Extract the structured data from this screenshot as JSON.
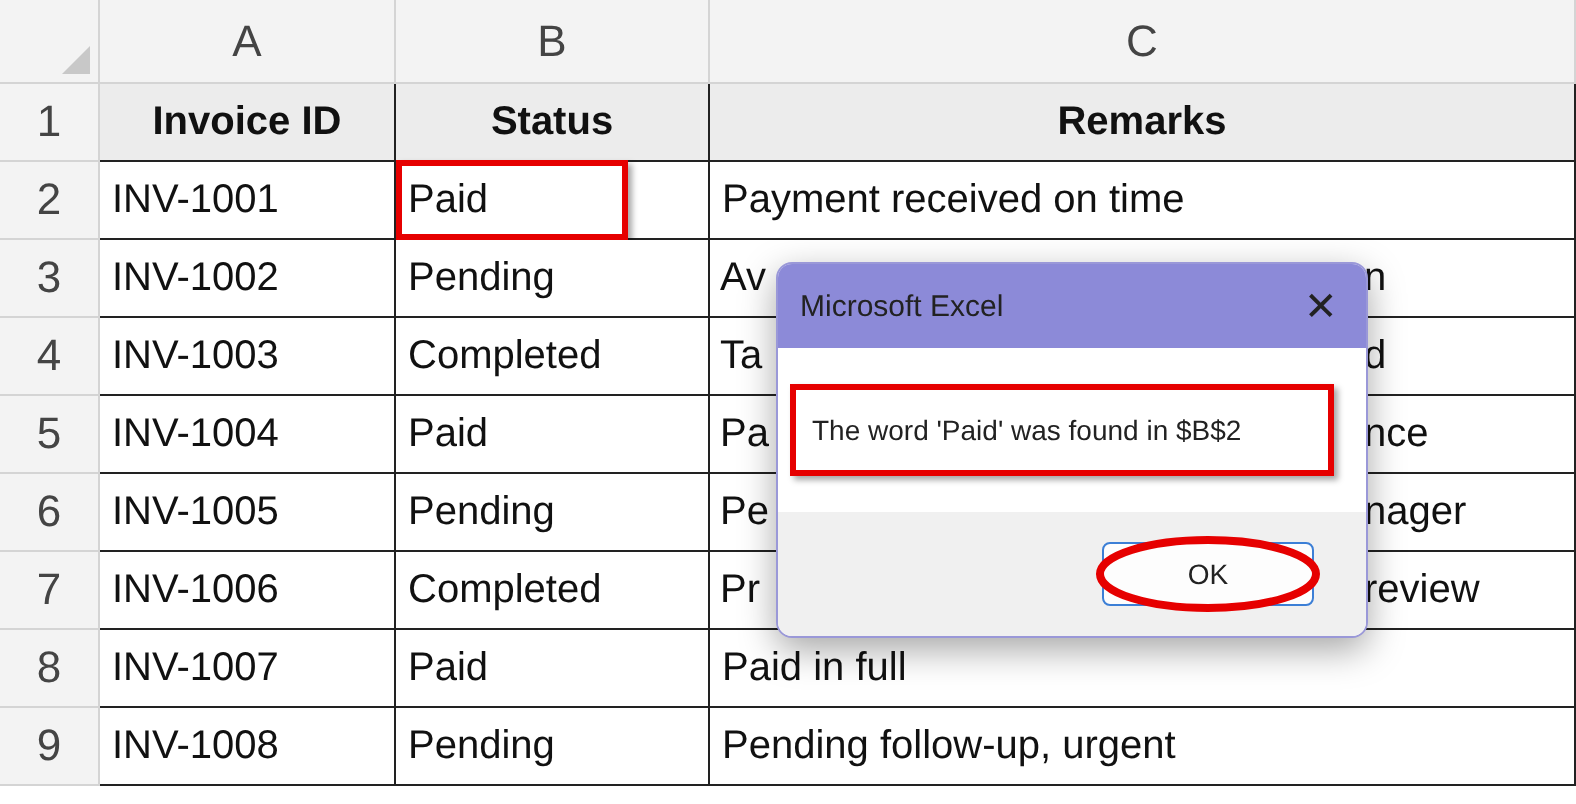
{
  "columns": [
    "A",
    "B",
    "C"
  ],
  "rows": [
    {
      "number": "1",
      "kind": "header",
      "cells": [
        {
          "text": "Invoice ID"
        },
        {
          "text": "Status"
        },
        {
          "text": "Remarks"
        }
      ]
    },
    {
      "number": "2",
      "kind": "data",
      "cells": [
        {
          "text": "INV-1001"
        },
        {
          "text": "Paid",
          "highlighted": true
        },
        {
          "text": "Payment received on time"
        }
      ]
    },
    {
      "number": "3",
      "kind": "data",
      "cells": [
        {
          "text": "INV-1002"
        },
        {
          "text": "Pending",
          "highlighted": false
        },
        {
          "before": "Av",
          "after": "n"
        }
      ]
    },
    {
      "number": "4",
      "kind": "data",
      "cells": [
        {
          "text": "INV-1003"
        },
        {
          "text": "Completed",
          "highlighted": false
        },
        {
          "before": "Ta",
          "after": "d"
        }
      ]
    },
    {
      "number": "5",
      "kind": "data",
      "cells": [
        {
          "text": "INV-1004"
        },
        {
          "text": "Paid",
          "highlighted": false
        },
        {
          "before": "Pa",
          "after": "nce"
        }
      ]
    },
    {
      "number": "6",
      "kind": "data",
      "cells": [
        {
          "text": "INV-1005"
        },
        {
          "text": "Pending",
          "highlighted": false
        },
        {
          "before": "Pe",
          "after": "nager"
        }
      ]
    },
    {
      "number": "7",
      "kind": "data",
      "cells": [
        {
          "text": "INV-1006"
        },
        {
          "text": "Completed",
          "highlighted": false
        },
        {
          "before": "Pr",
          "after": "review"
        }
      ]
    },
    {
      "number": "8",
      "kind": "data",
      "cells": [
        {
          "text": "INV-1007"
        },
        {
          "text": "Paid",
          "highlighted": false
        },
        {
          "text": "Paid in full"
        }
      ]
    },
    {
      "number": "9",
      "kind": "data",
      "cells": [
        {
          "text": "INV-1008"
        },
        {
          "text": "Pending",
          "highlighted": false
        },
        {
          "text": "Pending follow-up, urgent"
        }
      ]
    }
  ],
  "dialog": {
    "title": "Microsoft Excel",
    "close": "✕",
    "message": "The word 'Paid' was found in $B$2",
    "message_highlighted": true,
    "ok": "OK",
    "ok_highlighted": true
  }
}
